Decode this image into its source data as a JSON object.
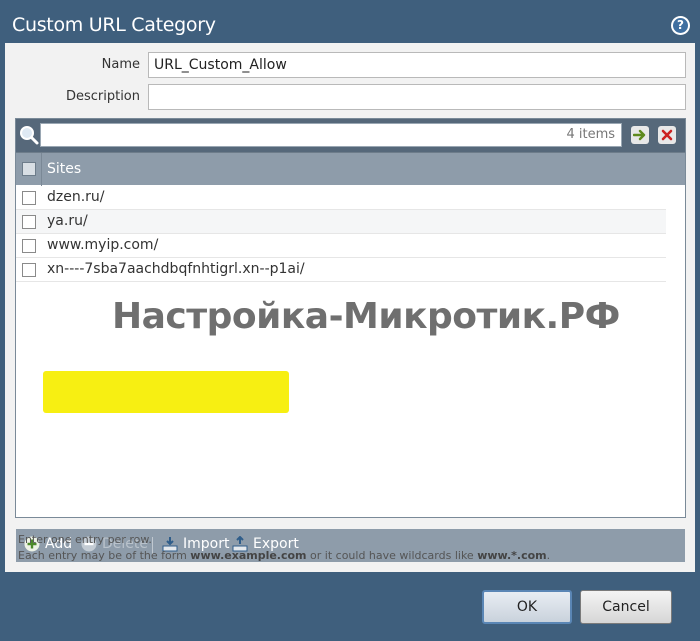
{
  "window": {
    "title": "Custom URL Category",
    "help_icon": "question-mark-icon"
  },
  "form": {
    "name_label": "Name",
    "name_value": "URL_Custom_Allow",
    "description_label": "Description",
    "description_value": ""
  },
  "grid": {
    "search_placeholder": "",
    "item_count": "4 items",
    "header": "Sites",
    "rows": [
      {
        "site": "dzen.ru/"
      },
      {
        "site": "ya.ru/"
      },
      {
        "site": "www.myip.com/"
      },
      {
        "site": "xn----7sba7aachdbqfnhtigrl.xn--p1ai/"
      }
    ],
    "footer": {
      "add_label": "Add",
      "delete_label": "Delete",
      "import_label": "Import",
      "export_label": "Export"
    }
  },
  "watermark": "Настройка-Микротик.РФ",
  "hint": {
    "line1": "Enter one entry per row.",
    "line2_a": "Each entry may be of the form ",
    "line2_b": "www.example.com",
    "line2_c": " or it could have wildcards like ",
    "line2_d": "www.*.com",
    "line2_e": "."
  },
  "buttons": {
    "ok": "OK",
    "cancel": "Cancel"
  },
  "colors": {
    "highlight": "#f7ef12",
    "frame": "#3f5f7d",
    "toolbar": "#56687a",
    "header": "#8e9caa"
  }
}
